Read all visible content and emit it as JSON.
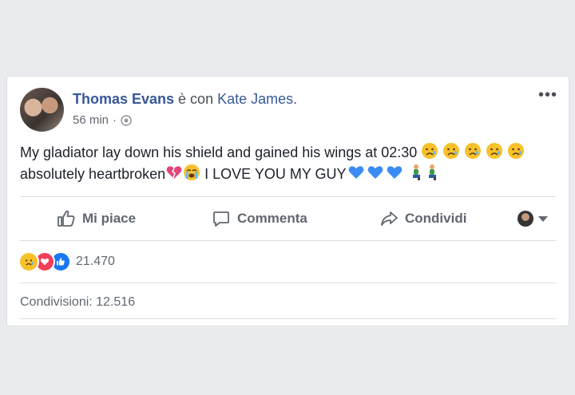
{
  "post": {
    "author": "Thomas Evans",
    "connector": " è con ",
    "tagged": "Kate James.",
    "time": "56 min",
    "dot": "·",
    "text_line1": "My gladiator lay down his shield and gained his wings at 02:30",
    "text_line2a": "absolutely heartbroken",
    "text_line2b": " I LOVE YOU MY GUY"
  },
  "actions": {
    "like": "Mi piace",
    "comment": "Commenta",
    "share": "Condividi"
  },
  "stats": {
    "reactions_count": "21.470",
    "shares": "Condivisioni: 12.516"
  },
  "colors": {
    "link": "#365899",
    "like_blue": "#1877f2",
    "love_red": "#f33e58",
    "sad_yellow": "#f7b125",
    "heart_blue": "#3b8bf5",
    "broken_heart_pink": "#e2457a"
  },
  "icons": [
    "more-options-icon",
    "globe-icon",
    "thumbs-up-icon",
    "comment-icon",
    "share-arrow-icon",
    "caret-down-icon",
    "sad-emoji-icon",
    "crying-emoji-icon",
    "broken-heart-icon",
    "blue-heart-icon",
    "kneeling-person-icon"
  ]
}
